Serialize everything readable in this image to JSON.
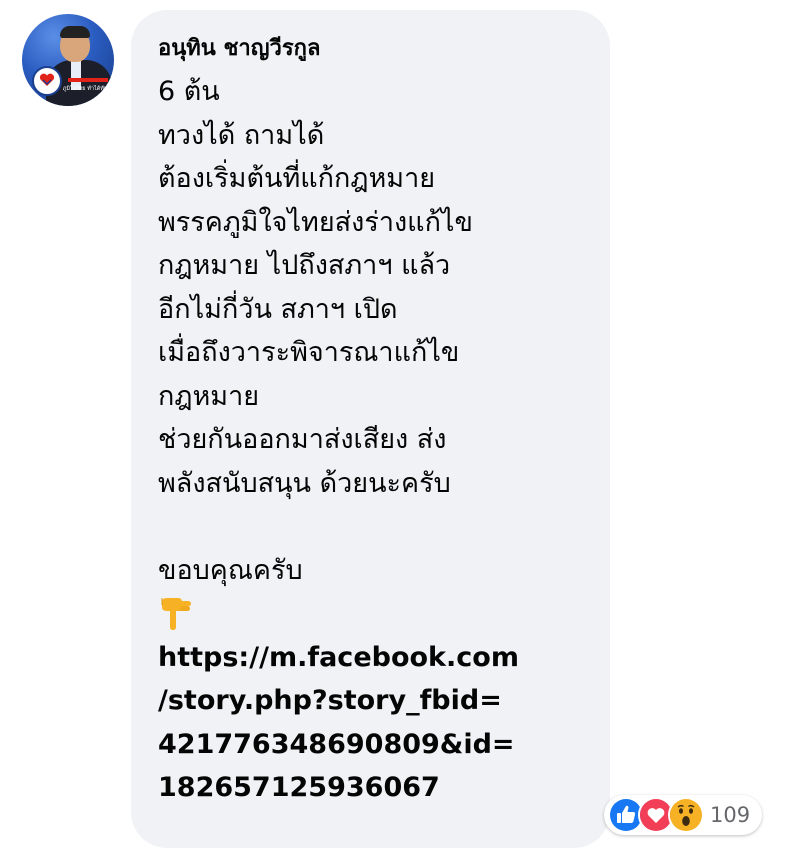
{
  "comment": {
    "author": "อนุทิน ชาญวีรกูล",
    "message_lines": [
      "6 ต้น",
      "ทวงได้ ถามได้",
      "ต้องเริ่มต้นที่แก้กฎหมาย",
      "พรรคภูมิใจไทยส่งร่างแก้ไข",
      "กฎหมาย ไปถึงสภาฯ แล้ว",
      "อีกไม่กี่วัน สภาฯ เปิด",
      "เมื่อถึงวาระพิจารณาแก้ไข",
      "กฎหมาย",
      "ช่วยกันออกมาส่งเสียง ส่ง",
      "พลังสนับสนุน ด้วยนะครับ",
      "",
      "ขอบคุณครับ"
    ],
    "emoji": "pointing-down-hand",
    "link_lines": [
      "https://m.facebook.com",
      "/story.php?story_fbid=",
      "421776348690809&id=",
      "182657125936067"
    ]
  },
  "avatar": {
    "tagline": "ภูมิใจไทย ทำได้ทันที"
  },
  "reactions": {
    "icons": [
      "like-icon",
      "love-icon",
      "wow-icon"
    ],
    "count": "109"
  },
  "colors": {
    "bubble": "#f0f2f5",
    "text": "#050505",
    "like": "#1877f2",
    "love": "#f33e58",
    "wow": "#f7b125",
    "count": "#65676b"
  }
}
